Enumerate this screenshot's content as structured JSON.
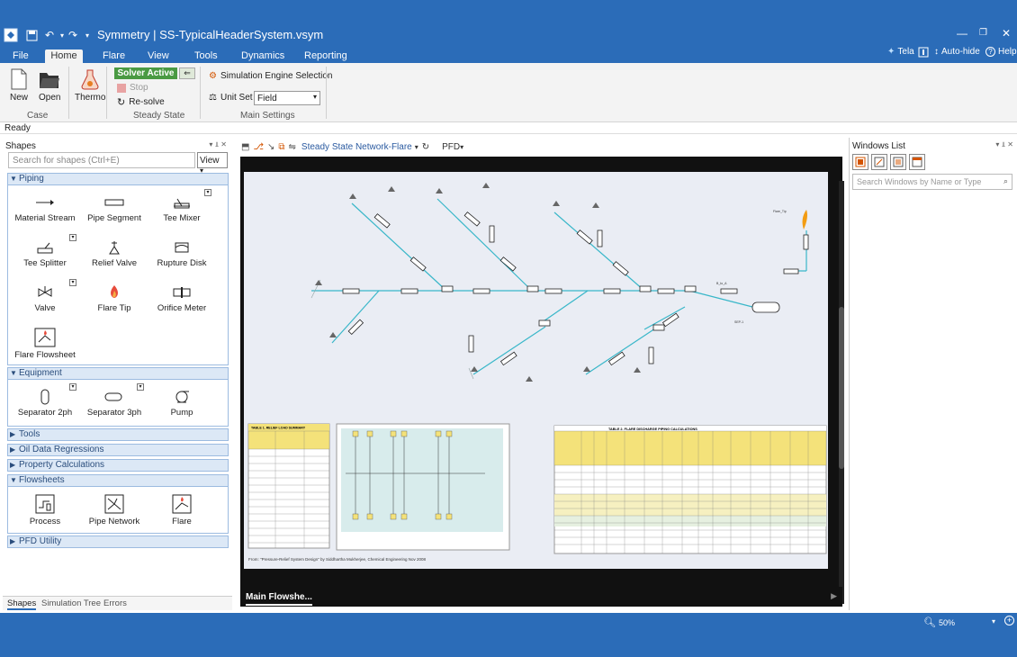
{
  "app": {
    "title": "Symmetry | SS-TypicalHeaderSystem.vsym"
  },
  "tabs": [
    {
      "label": "File"
    },
    {
      "label": "Home"
    },
    {
      "label": "Flare"
    },
    {
      "label": "View"
    },
    {
      "label": "Tools"
    },
    {
      "label": "Dynamics"
    },
    {
      "label": "Reporting"
    }
  ],
  "topright": {
    "tela": "Tela",
    "autohide": "Auto-hide",
    "help": "Help"
  },
  "ribbon": {
    "case": {
      "label": "Case",
      "new": "New",
      "open": "Open"
    },
    "thermo": "Thermo",
    "steady": {
      "label": "Steady State",
      "solver": "Solver Active",
      "stop": "Stop",
      "resolve": "Re-solve"
    },
    "main": {
      "label": "Main Settings",
      "engine": "Simulation Engine Selection",
      "unitset": "Unit Set",
      "unitset_value": "Field"
    }
  },
  "status": "Ready",
  "left": {
    "title": "Shapes",
    "search_placeholder": "Search for shapes (Ctrl+E)",
    "view": "View",
    "sections": {
      "piping": "Piping",
      "equipment": "Equipment",
      "tools": "Tools",
      "oil": "Oil Data Regressions",
      "property": "Property Calculations",
      "flowsheets": "Flowsheets",
      "pfd": "PFD Utility"
    },
    "piping": [
      "Material Stream",
      "Pipe Segment",
      "Tee Mixer",
      "Tee Splitter",
      "Relief Valve",
      "Rupture Disk",
      "Valve",
      "Flare Tip",
      "Orifice Meter",
      "Flare Flowsheet"
    ],
    "equipment": [
      "Separator 2ph",
      "Separator 3ph",
      "Pump"
    ],
    "flowsheets": [
      "Process",
      "Pipe Network",
      "Flare"
    ],
    "bottom_tabs": [
      "Shapes",
      "Simulation Tree",
      "Errors"
    ]
  },
  "center": {
    "network": "Steady State Network-Flare",
    "pfd": "PFD",
    "tab": "Main Flowshe...",
    "caption": "From: \"Pressure-Relief System Design\" by Siddhartha Mukherjee, Chemical Engineering Nov 2008",
    "table1_title": "TABLE 1. RELIEF LOAD SUMMARY",
    "table2_title": "TABLE 2. FLARE DISCHARGE PIPING CALCULATIONS"
  },
  "right": {
    "title": "Windows List",
    "search_placeholder": "Search Windows by Name or Type"
  },
  "bottom": {
    "zoom": "50%"
  }
}
